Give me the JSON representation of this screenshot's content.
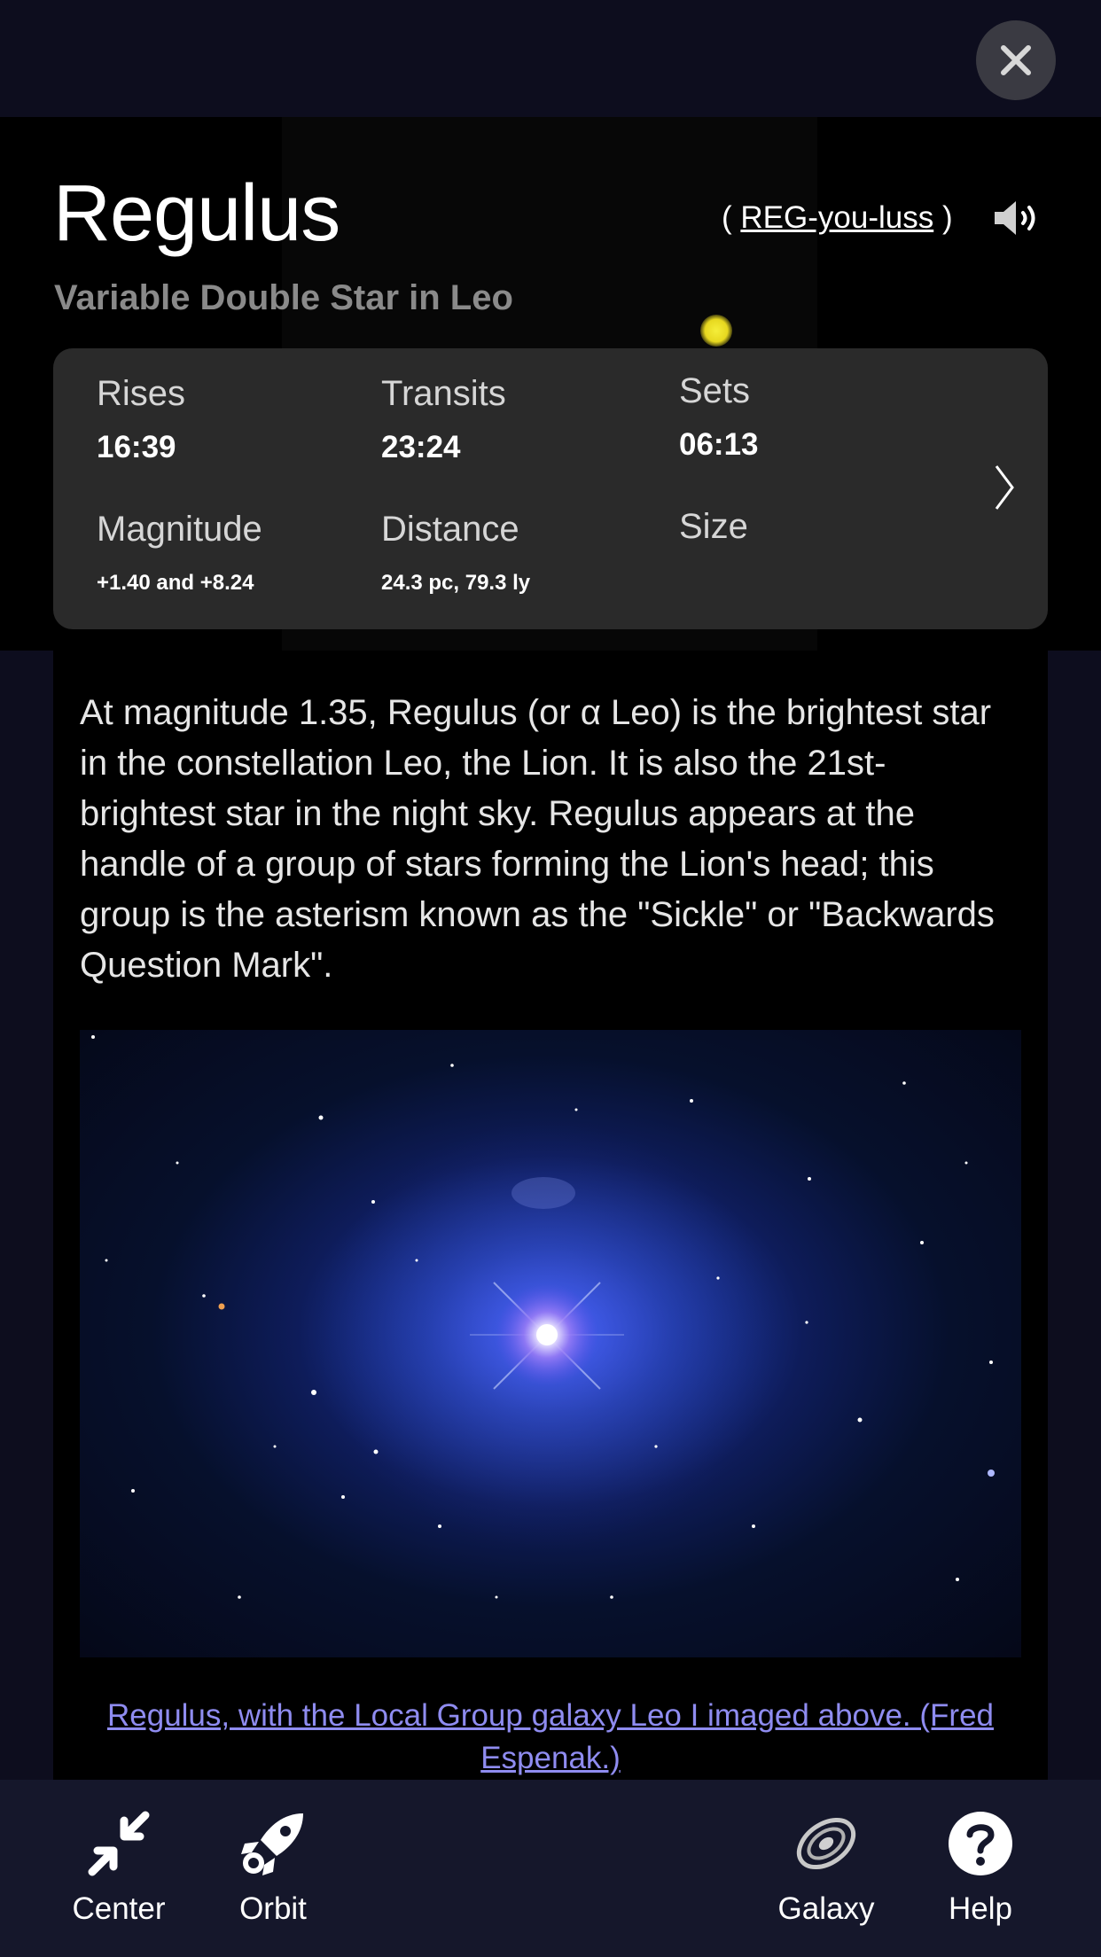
{
  "header": {
    "title": "Regulus",
    "subtitle": "Variable Double Star in Leo",
    "pronunciation_open": "(",
    "pronunciation": "REG-you-luss",
    "pronunciation_close": ")"
  },
  "info": {
    "rises_label": "Rises",
    "rises_value": "16:39",
    "transits_label": "Transits",
    "transits_value": "23:24",
    "sets_label": "Sets",
    "sets_value": "06:13",
    "magnitude_label": "Magnitude",
    "magnitude_value": "+1.40 and +8.24",
    "distance_label": "Distance",
    "distance_value": "24.3 pc, 79.3 ly",
    "size_label": "Size"
  },
  "description": "At magnitude 1.35, Regulus (or α Leo) is the brightest star in the constellation Leo, the Lion. It is also the 21st-brightest star in the night sky. Regulus appears at the handle of a group of stars forming the Lion's head; this group is the asterism known as the \"Sickle\" or \"Backwards Question Mark\".",
  "photo": {
    "caption": "Regulus, with the Local Group galaxy Leo I imaged above. (Fred Espenak.)"
  },
  "tabs": [
    {
      "label": "Center",
      "icon": "collapse-arrows-icon"
    },
    {
      "label": "Orbit",
      "icon": "rocket-icon"
    },
    {
      "label": "Galaxy",
      "icon": "galaxy-icon"
    },
    {
      "label": "Help",
      "icon": "help-icon"
    }
  ],
  "colors": {
    "background": "#0d0d1e",
    "card": "#2a2a2a",
    "caption_link": "#8f8cf0",
    "bottom_bar": "#15172b"
  }
}
